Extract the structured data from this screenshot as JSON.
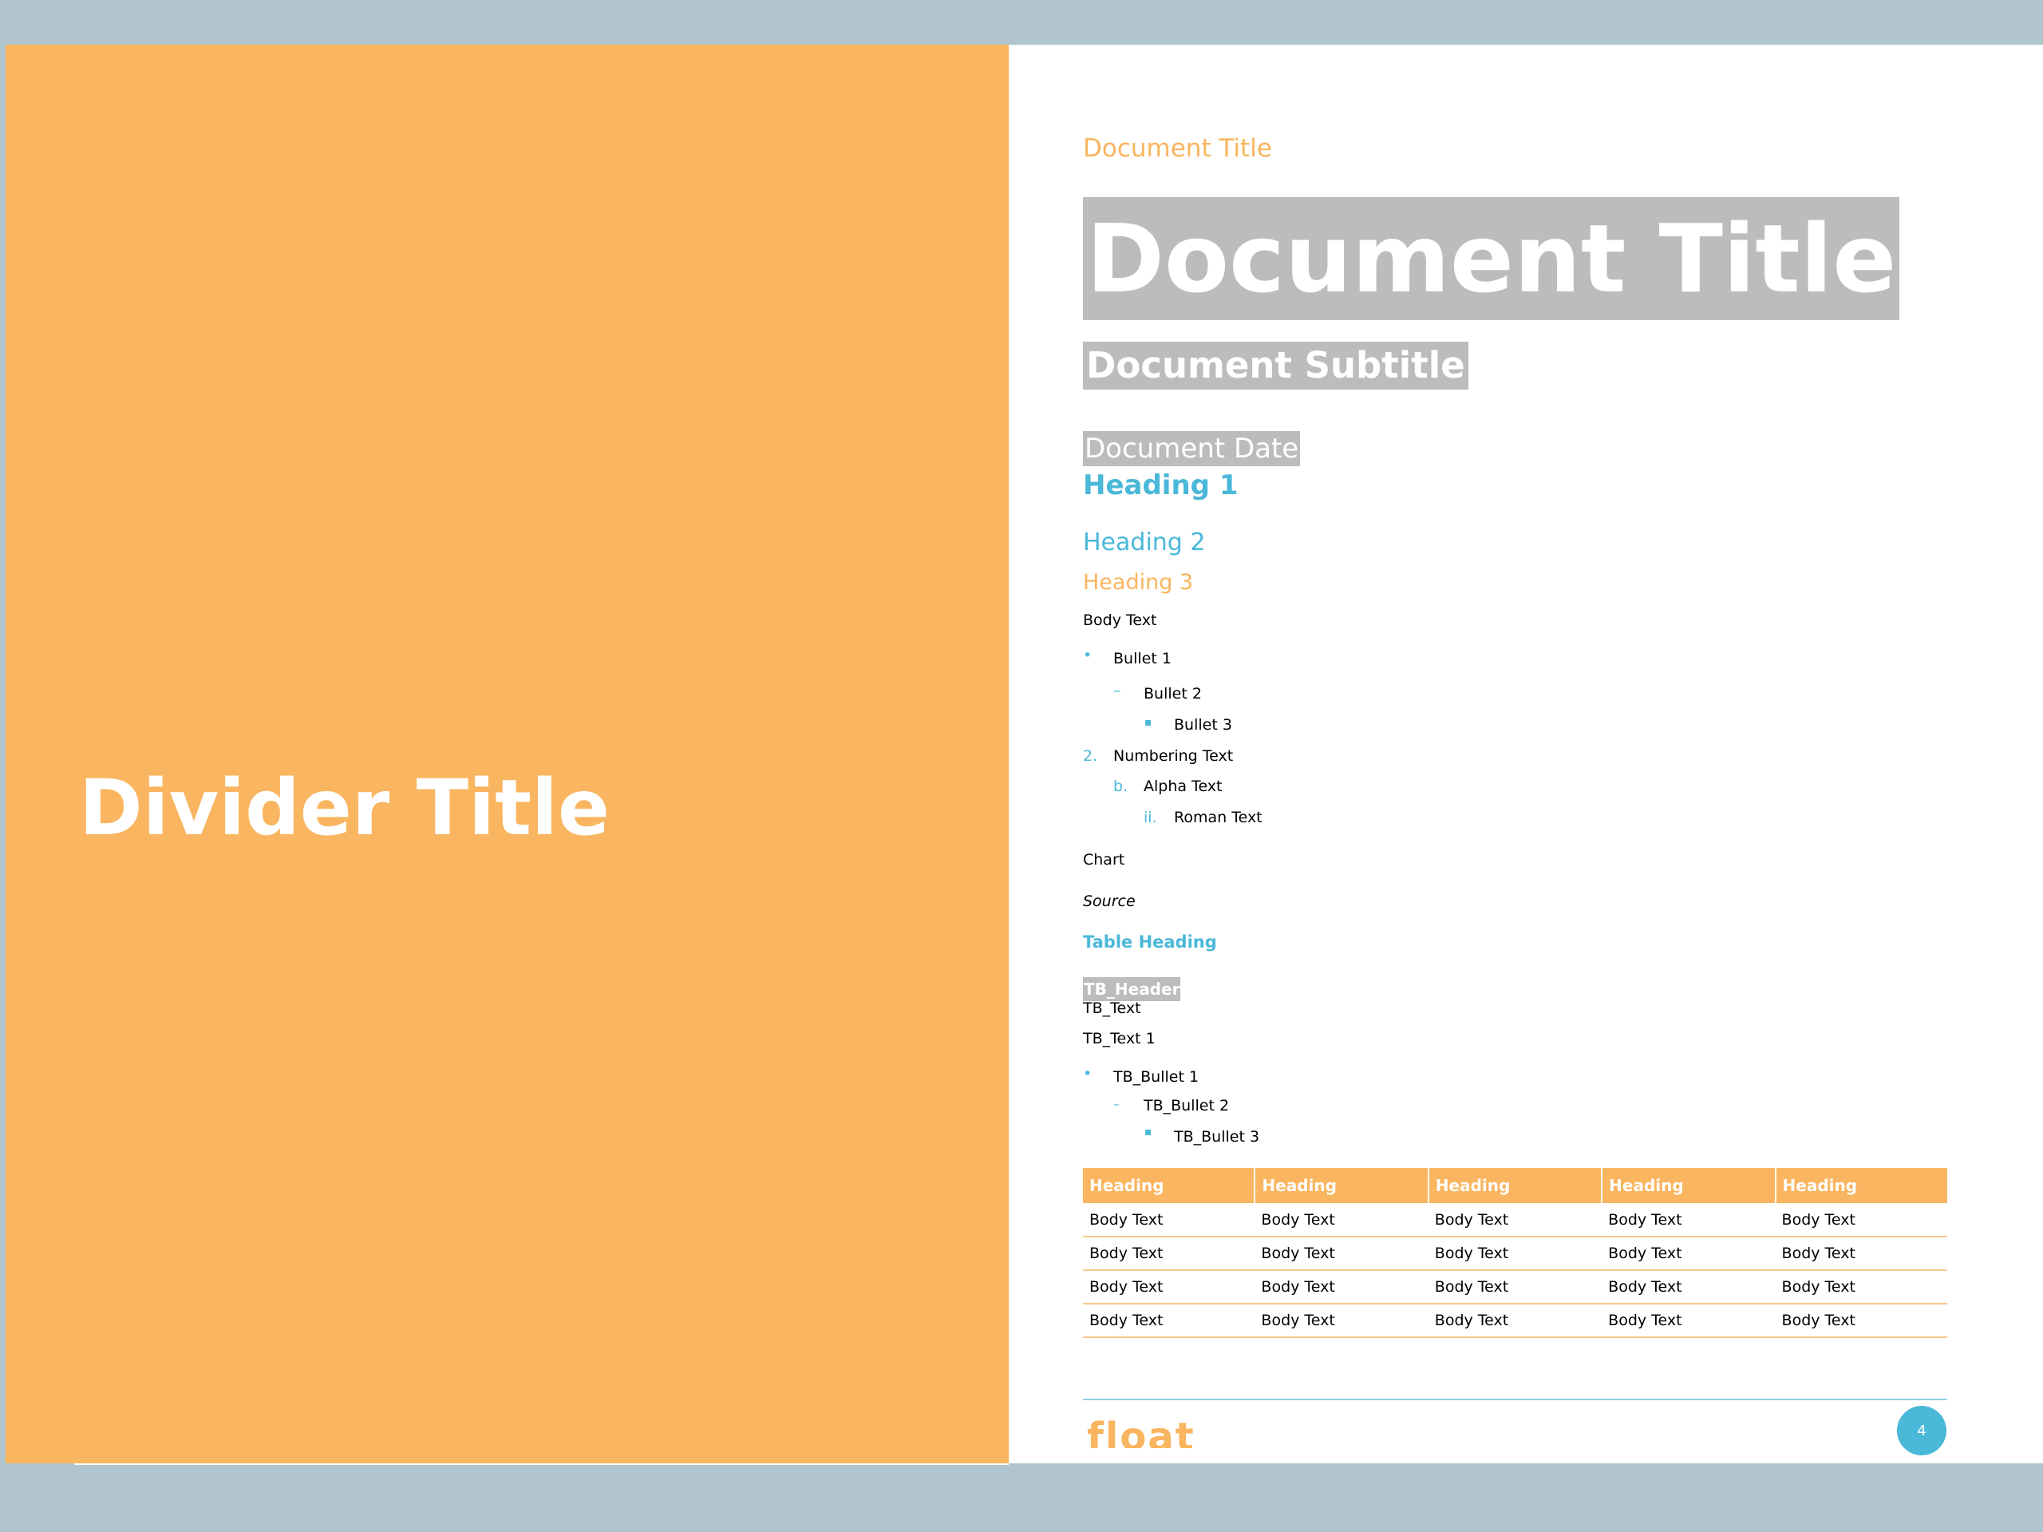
{
  "divider": {
    "title": "Divider Title"
  },
  "document": {
    "title_small": "Document Title",
    "title_large": "Document Title",
    "subtitle": "Document Subtitle",
    "date": "Document Date"
  },
  "headings": {
    "h1": "Heading 1",
    "h2": "Heading 2",
    "h3": "Heading 3"
  },
  "body_text": "Body Text",
  "bullets": [
    {
      "marker": "•",
      "text": "Bullet 1"
    },
    {
      "marker": "–",
      "text": "Bullet 2"
    },
    {
      "marker": "▪",
      "text": "Bullet 3"
    }
  ],
  "numbered": [
    {
      "marker": "2.",
      "text": "Numbering Text"
    },
    {
      "marker": "b.",
      "text": "Alpha Text"
    },
    {
      "marker": "ii.",
      "text": "Roman Text"
    }
  ],
  "chart_label": "Chart",
  "source_label": "Source",
  "table_heading": "Table Heading",
  "tb": {
    "header": "TB_Header",
    "text": "TB_Text",
    "text1": "TB_Text 1",
    "bullets": [
      {
        "marker": "•",
        "text": "TB_Bullet 1"
      },
      {
        "marker": "–",
        "text": "TB_Bullet 2"
      },
      {
        "marker": "▪",
        "text": "TB_Bullet 3"
      }
    ]
  },
  "table": {
    "headers": [
      "Heading",
      "Heading",
      "Heading",
      "Heading",
      "Heading"
    ],
    "rows": [
      [
        "Body Text",
        "Body Text",
        "Body Text",
        "Body Text",
        "Body Text"
      ],
      [
        "Body Text",
        "Body Text",
        "Body Text",
        "Body Text",
        "Body Text"
      ],
      [
        "Body Text",
        "Body Text",
        "Body Text",
        "Body Text",
        "Body Text"
      ],
      [
        "Body Text",
        "Body Text",
        "Body Text",
        "Body Text",
        "Body Text"
      ]
    ]
  },
  "footer": {
    "logo": "float",
    "page_number": "4"
  },
  "colors": {
    "orange": "#f9b55f",
    "blue": "#4ab8d8",
    "gray_highlight": "#bcbcbc",
    "background": "#b0c5cd"
  }
}
